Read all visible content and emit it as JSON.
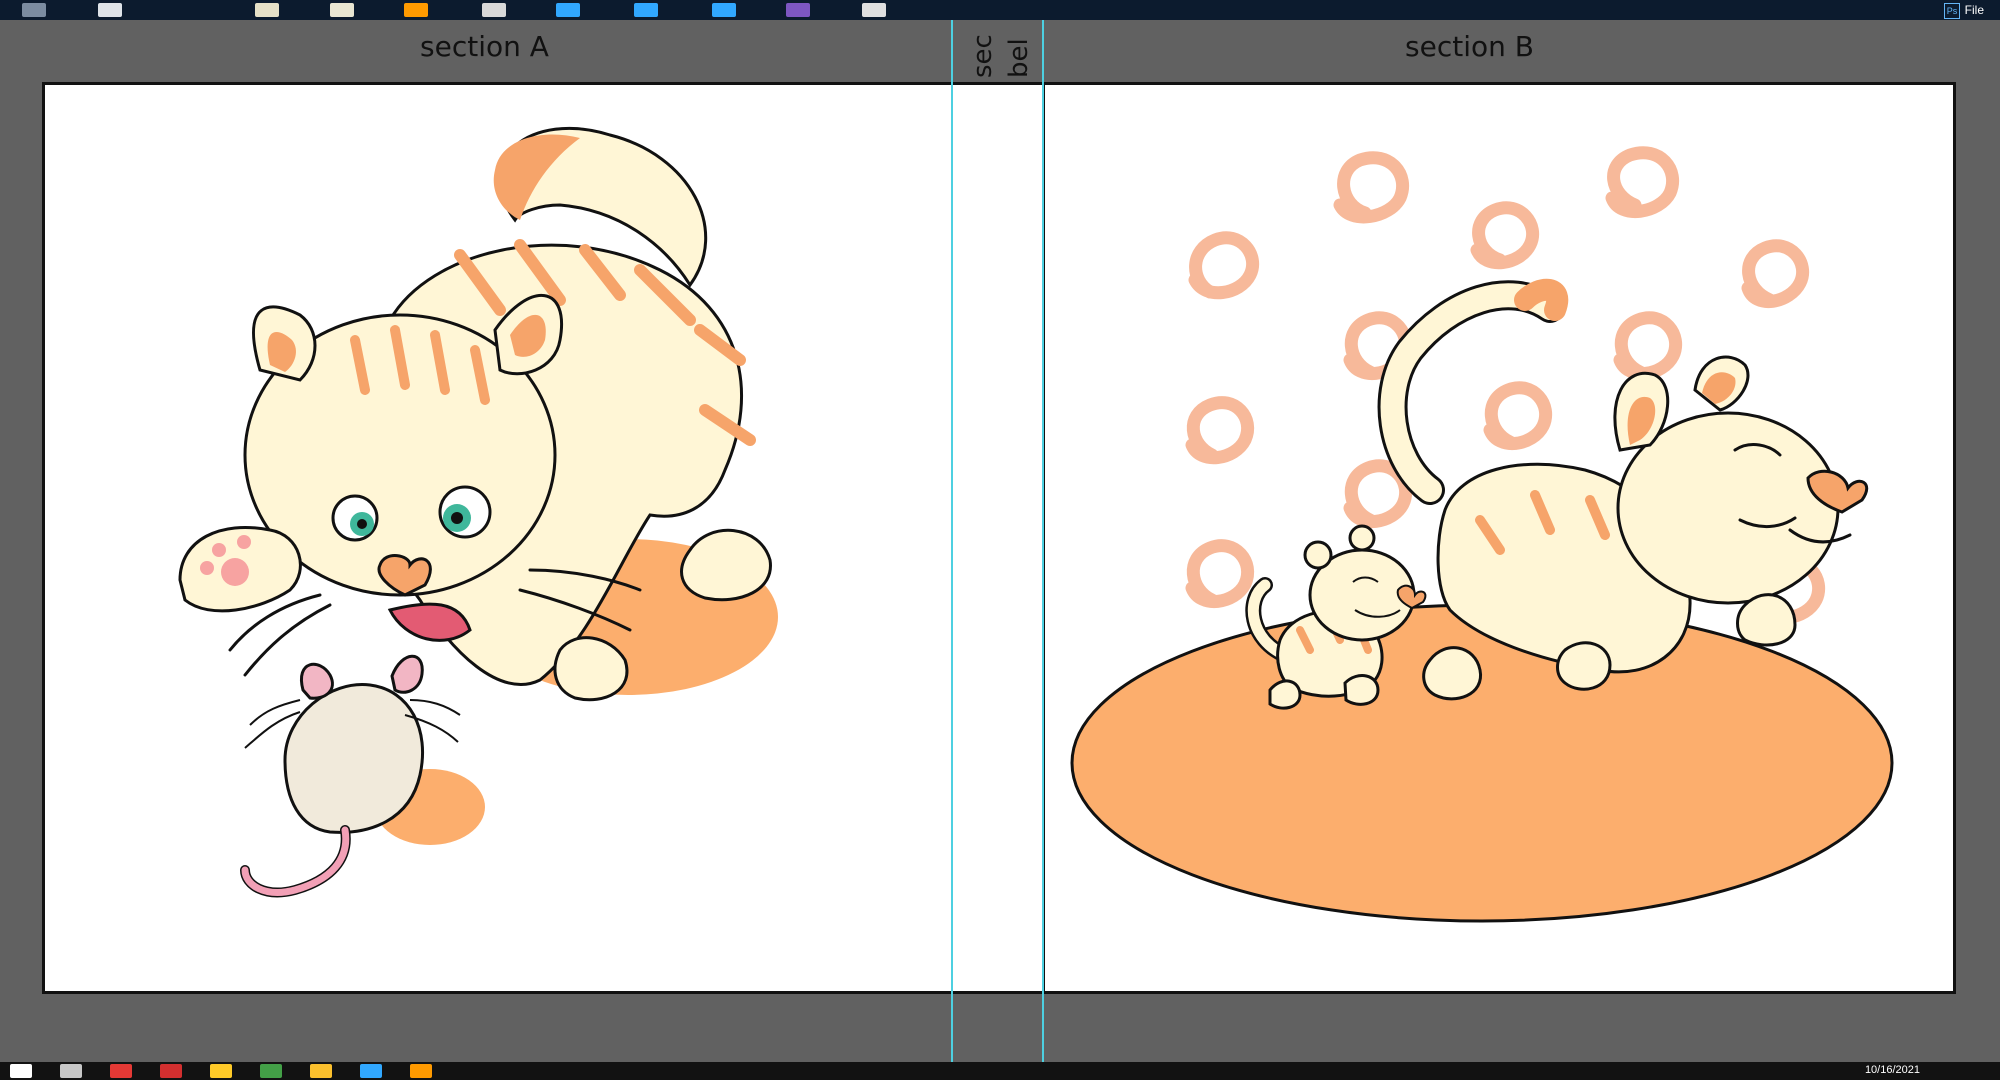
{
  "sections": {
    "a_title": "section A",
    "b_title": "section B",
    "vertical_label": "sec bel"
  },
  "topbar": {
    "file_label": "File",
    "ps_label": "Ps"
  },
  "taskbar": {
    "date": "10/16/2021"
  },
  "colors": {
    "workspace": "#616161",
    "guide": "#4dd0e1",
    "cat_fill": "#fff6d6",
    "cat_stripe": "#f6a46a",
    "shadow_orange": "#fcae6d",
    "swirl": "#f7b99a"
  }
}
